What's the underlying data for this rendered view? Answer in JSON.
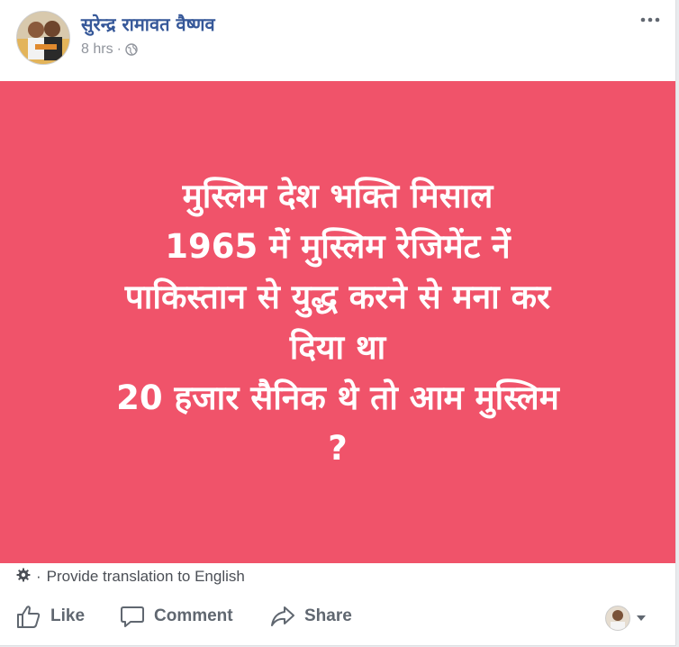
{
  "post": {
    "author": "सुरेन्द्र रामावत वैष्णव",
    "timestamp": "8 hrs",
    "separator": "·",
    "privacy_icon": "globe-icon",
    "more_icon": "more-options-icon"
  },
  "banner": {
    "background_color": "#f0536a",
    "text_color": "#ffffff",
    "lines": [
      "मुस्लिम देश भक्ति मिसाल",
      "1965 में मुस्लिम रेजिमेंट नें",
      "पाकिस्तान से युद्ध करने से मना कर",
      "दिया था",
      "20 हजार सैनिक थे तो आम मुस्लिम",
      "?"
    ]
  },
  "translation": {
    "icon": "gear-icon",
    "separator": "·",
    "label": "Provide translation to English"
  },
  "actions": {
    "like_label": "Like",
    "comment_label": "Comment",
    "share_label": "Share"
  }
}
